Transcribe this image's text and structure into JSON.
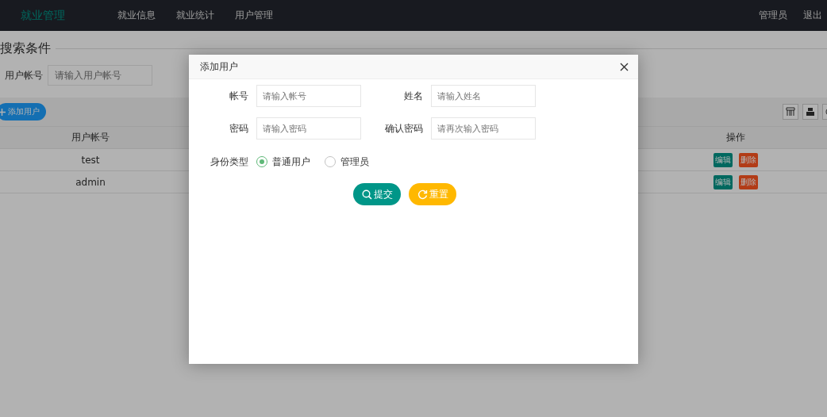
{
  "nav": {
    "brand": "就业管理",
    "items": [
      {
        "label": "就业信息"
      },
      {
        "label": "就业统计"
      },
      {
        "label": "用户管理"
      }
    ],
    "user": "管理员",
    "logout": "退出"
  },
  "search": {
    "title": "搜索条件",
    "fields": [
      {
        "label": "用户帐号",
        "placeholder": "请输入用户帐号"
      }
    ]
  },
  "toolbar": {
    "add_button": "添加用户"
  },
  "table": {
    "columns": [
      "用户帐号",
      "操作"
    ],
    "rows": [
      {
        "cells": [
          "test"
        ],
        "actions": [
          {
            "label": "编辑",
            "kind": "edit"
          },
          {
            "label": "删除",
            "kind": "delete"
          }
        ]
      },
      {
        "cells": [
          "admin"
        ],
        "actions": [
          {
            "label": "编辑",
            "kind": "edit"
          },
          {
            "label": "删除",
            "kind": "delete"
          }
        ]
      }
    ]
  },
  "dialog": {
    "title": "添加用户",
    "fields": [
      {
        "label": "帐号",
        "placeholder": "请输入帐号"
      },
      {
        "label": "姓名",
        "placeholder": "请输入姓名"
      },
      {
        "label": "密码",
        "placeholder": "请输入密码"
      },
      {
        "label": "确认密码",
        "placeholder": "请再次输入密码"
      }
    ],
    "radio": {
      "label": "身份类型",
      "options": [
        {
          "label": "普通用户",
          "selected": true
        },
        {
          "label": "管理员",
          "selected": false
        }
      ]
    },
    "buttons": [
      {
        "label": "提交",
        "kind": "submit"
      },
      {
        "label": "重置",
        "kind": "reset"
      }
    ]
  }
}
